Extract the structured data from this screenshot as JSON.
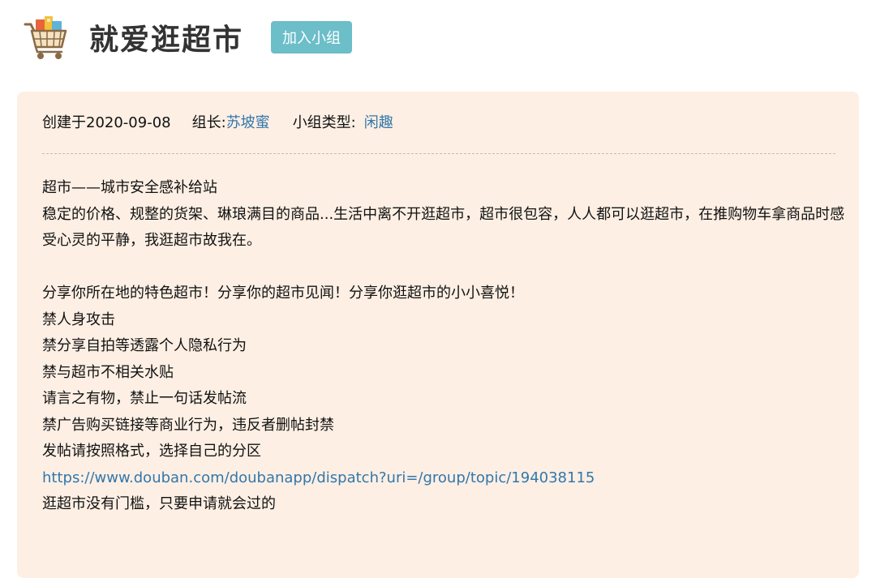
{
  "header": {
    "title": "就爱逛超市",
    "join_label": "加入小组",
    "icon": "shopping-cart-icon"
  },
  "meta": {
    "created_label": "创建于2020-09-08",
    "leader_label": "组长:",
    "leader_name": "苏坡蜜",
    "type_label": "小组类型:",
    "type_value": "闲趣"
  },
  "intro": {
    "line1": "超市——城市安全感补给站",
    "line2": "稳定的价格、规整的货架、琳琅满目的商品...生活中离不开逛超市，超市很包容，人人都可以逛超市，在推购物车拿商品时感受心灵的平静，我逛超市故我在。",
    "line3": "分享你所在地的特色超市！分享你的超市见闻！分享你逛超市的小小喜悦！",
    "line4": "禁人身攻击",
    "line5": "禁分享自拍等透露个人隐私行为",
    "line6": "禁与超市不相关水贴",
    "line7": "请言之有物，禁止一句话发帖流",
    "line8": "禁广告购买链接等商业行为，违反者删帖封禁",
    "line9": "发帖请按照格式，选择自己的分区",
    "link": "https://www.douban.com/doubanapp/dispatch?uri=/group/topic/194038115",
    "line10": "逛超市没有门槛，只要申请就会过的"
  },
  "colors": {
    "accent": "#6cbec9",
    "link": "#3377aa",
    "panel_bg": "#fdefe4"
  }
}
